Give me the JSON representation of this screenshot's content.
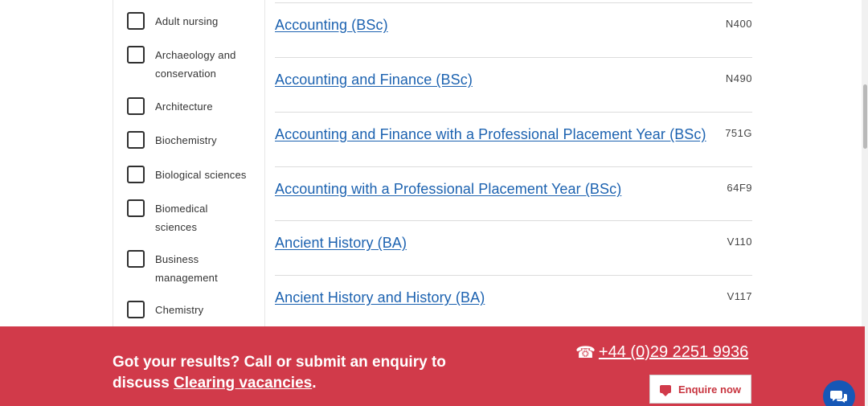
{
  "filters": {
    "items": [
      {
        "label": "Adult nursing"
      },
      {
        "label": "Archaeology and conservation"
      },
      {
        "label": "Architecture"
      },
      {
        "label": "Biochemistry"
      },
      {
        "label": "Biological sciences"
      },
      {
        "label": "Biomedical sciences"
      },
      {
        "label": "Business management"
      },
      {
        "label": "Chemistry"
      }
    ]
  },
  "results": [
    {
      "title": "Accounting (BSc)",
      "code": "N400"
    },
    {
      "title": "Accounting and Finance (BSc)",
      "code": "N490"
    },
    {
      "title": "Accounting and Finance with a Professional Placement Year (BSc)",
      "code": "751G"
    },
    {
      "title": "Accounting with a Professional Placement Year (BSc)",
      "code": "64F9"
    },
    {
      "title": "Ancient History (BA)",
      "code": "V110"
    },
    {
      "title": "Ancient History and History (BA)",
      "code": "V117"
    }
  ],
  "banner": {
    "line1": "Got your results? Call or submit an enquiry to",
    "line2_prefix": "discuss ",
    "line2_link": "Clearing vacancies",
    "line2_suffix": ".",
    "phone_icon": "☎",
    "phone": "+44 (0)29 2251 9936",
    "enquire_label": "Enquire now"
  },
  "colors": {
    "link": "#1c62b0",
    "banner": "#d13a4a",
    "chat": "#1657b6"
  }
}
